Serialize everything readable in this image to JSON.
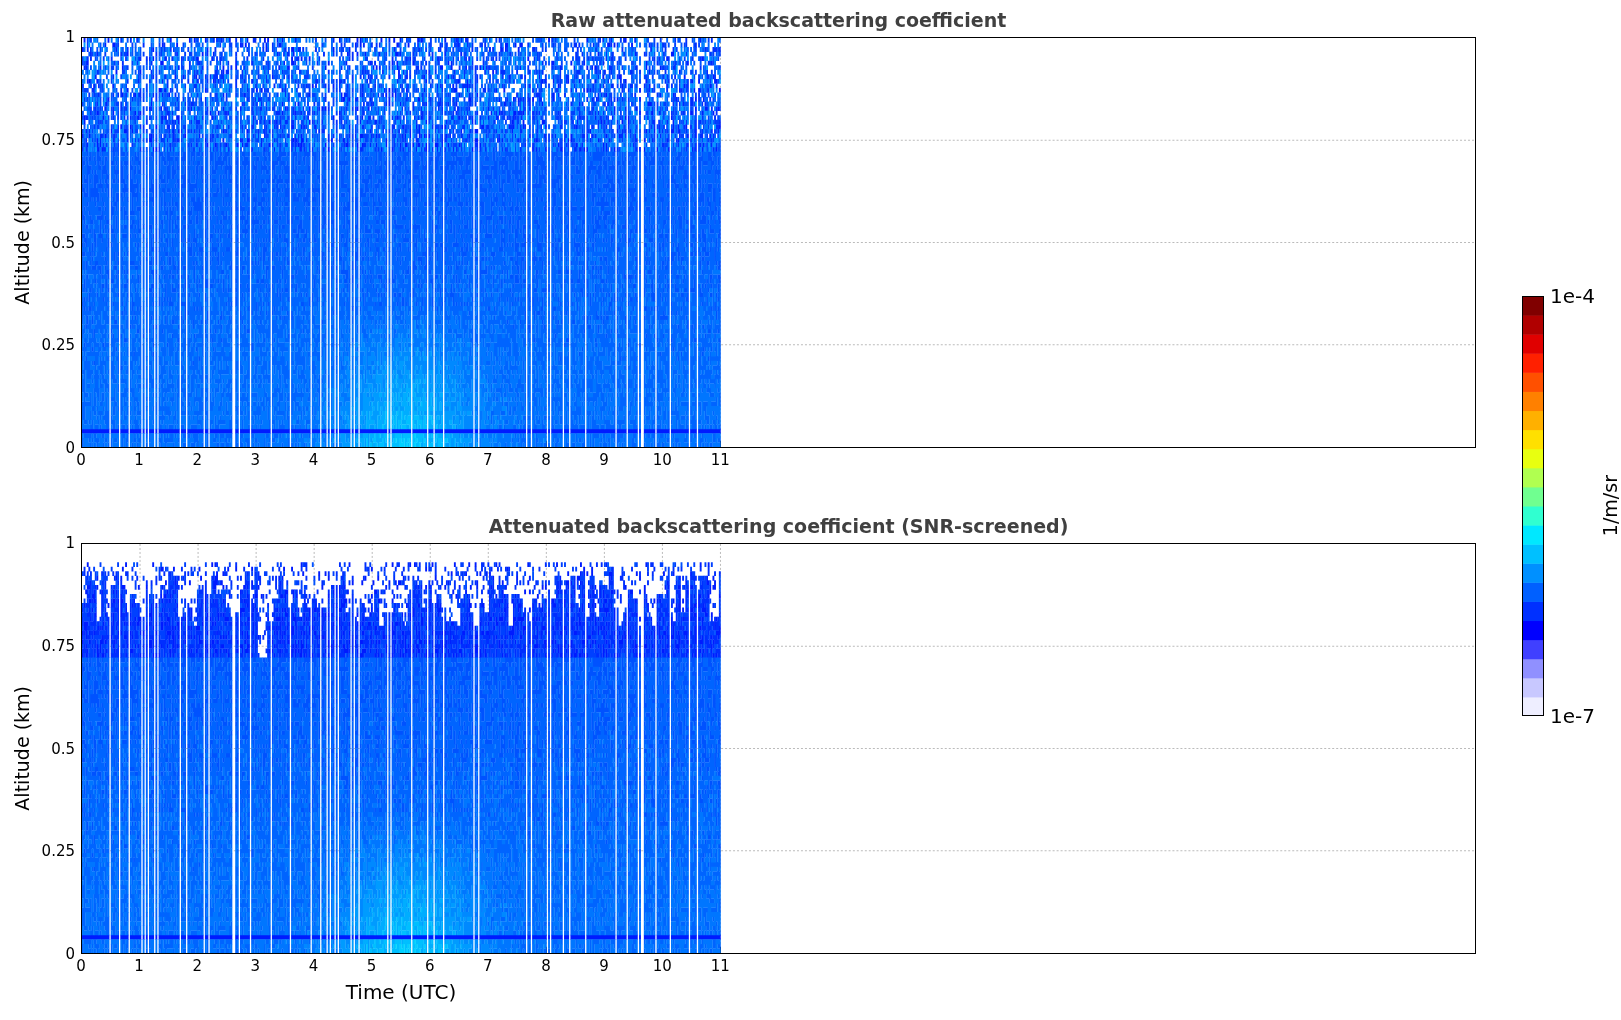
{
  "figure": {
    "panels": [
      {
        "title": "Raw attenuated backscattering coefficient",
        "kind": "raw",
        "ylabel": "Altitude (km)",
        "yticks": [
          "1",
          "0.75",
          "0.5",
          "0.25",
          "0"
        ],
        "xticks": [
          "0",
          "1",
          "2",
          "3",
          "4",
          "5",
          "6",
          "7",
          "8",
          "9",
          "10",
          "11"
        ]
      },
      {
        "title": "Attenuated backscattering coefficient (SNR-screened)",
        "kind": "screened",
        "ylabel": "Altitude (km)",
        "yticks": [
          "1",
          "0.75",
          "0.5",
          "0.25",
          "0"
        ],
        "xticks": [
          "0",
          "1",
          "2",
          "3",
          "4",
          "5",
          "6",
          "7",
          "8",
          "9",
          "10",
          "11"
        ]
      }
    ],
    "xlabel": "Time (UTC)",
    "colorbar": {
      "max_label": "1e-4",
      "min_label": "1e-7",
      "label": "1/m/sr"
    }
  }
}
